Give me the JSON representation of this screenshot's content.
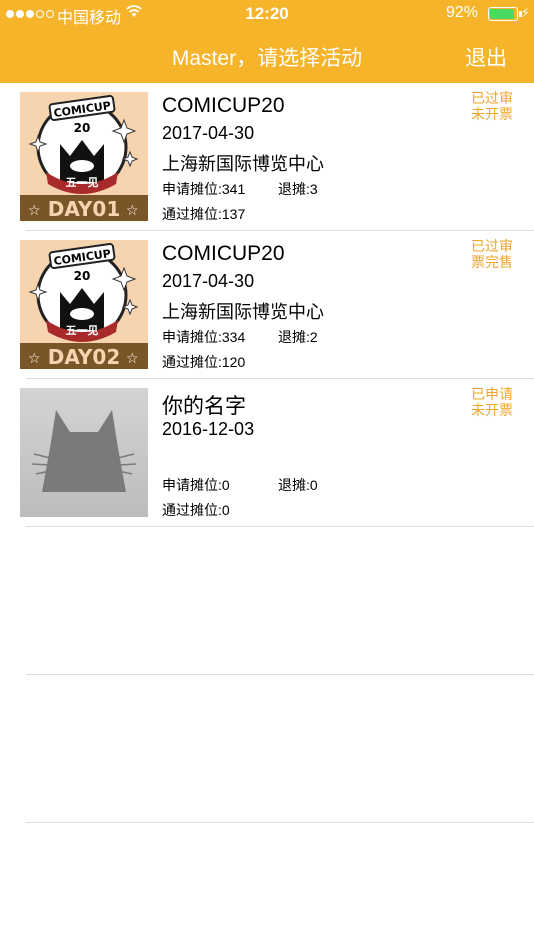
{
  "status_bar": {
    "carrier": "中国移动",
    "time": "12:20",
    "battery": "92%",
    "battery_level": 0.92
  },
  "nav": {
    "title": "Master，请选择活动",
    "logout": "退出"
  },
  "events": [
    {
      "thumb_icon": "comicup-day01-poster",
      "thumb_day": "DAY01",
      "title": "COMICUP20",
      "date": "2017-04-30",
      "venue": "上海新国际博览中心",
      "applied": "申请摊位:341",
      "withdrawn": "退摊:3",
      "approved": "通过摊位:137",
      "status_line1": "已过审",
      "status_line2": "未开票"
    },
    {
      "thumb_icon": "comicup-day02-poster",
      "thumb_day": "DAY02",
      "title": "COMICUP20",
      "date": "2017-04-30",
      "venue": "上海新国际博览中心",
      "applied": "申请摊位:334",
      "withdrawn": "退摊:2",
      "approved": "通过摊位:120",
      "status_line1": "已过审",
      "status_line2": "票完售"
    },
    {
      "thumb_icon": "cat-placeholder",
      "title": "你的名字",
      "date": "2016-12-03",
      "venue": "",
      "applied": "申请摊位:0",
      "withdrawn": "退摊:0",
      "approved": "通过摊位:0",
      "status_line1": "已申请",
      "status_line2": "未开票"
    }
  ],
  "poster_text": {
    "logo": "COMICUP",
    "num": "20",
    "sub": "五一见"
  },
  "colors": {
    "header": "#f6b42b",
    "status_text": "#f0a52a",
    "poster_band": "#7a5528"
  }
}
